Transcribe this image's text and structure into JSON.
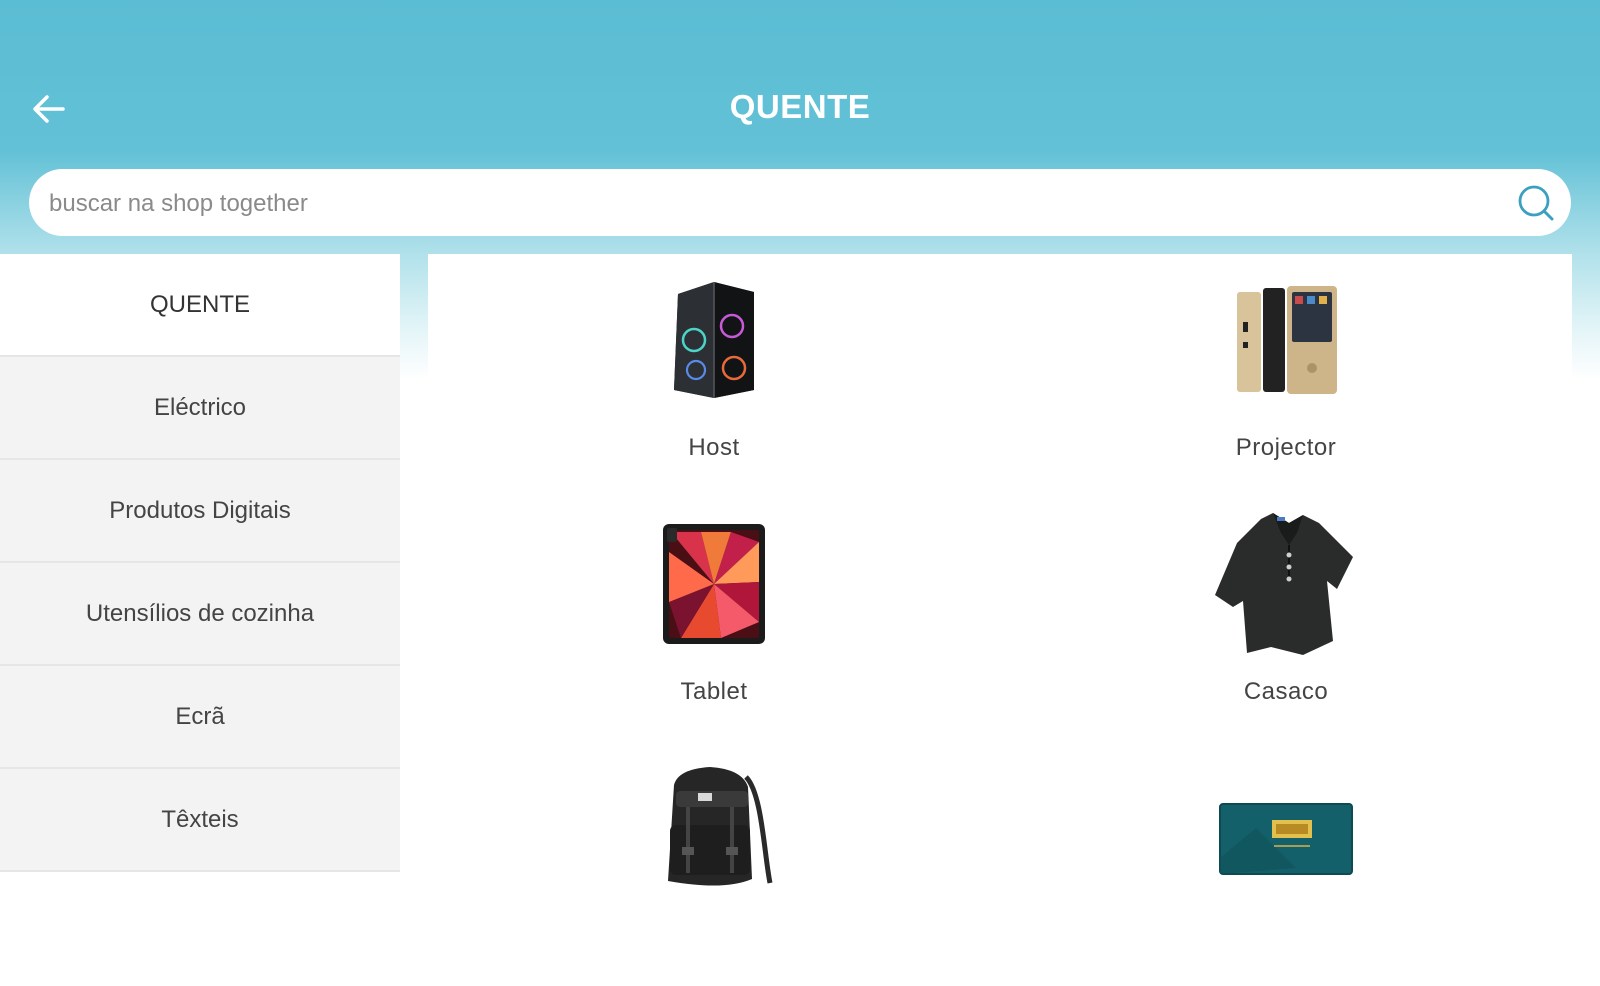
{
  "header": {
    "title": "QUENTE",
    "back_icon": "arrow-left-icon",
    "accent_color": "#5bbdd3"
  },
  "search": {
    "placeholder": "buscar na shop together",
    "value": "",
    "icon": "search-icon"
  },
  "sidebar": {
    "items": [
      {
        "label": "QUENTE",
        "active": true
      },
      {
        "label": "Eléctrico",
        "active": false
      },
      {
        "label": "Produtos Digitais",
        "active": false
      },
      {
        "label": "Utensílios de cozinha",
        "active": false
      },
      {
        "label": "Ecrã",
        "active": false
      },
      {
        "label": "Têxteis",
        "active": false
      }
    ]
  },
  "products": [
    {
      "label": "Host",
      "icon": "pc-case-icon"
    },
    {
      "label": "Projector",
      "icon": "projector-icon"
    },
    {
      "label": "Tablet",
      "icon": "tablet-icon"
    },
    {
      "label": "Casaco",
      "icon": "shirt-icon"
    },
    {
      "label": "",
      "icon": "backpack-icon"
    },
    {
      "label": "",
      "icon": "gift-box-icon"
    }
  ]
}
